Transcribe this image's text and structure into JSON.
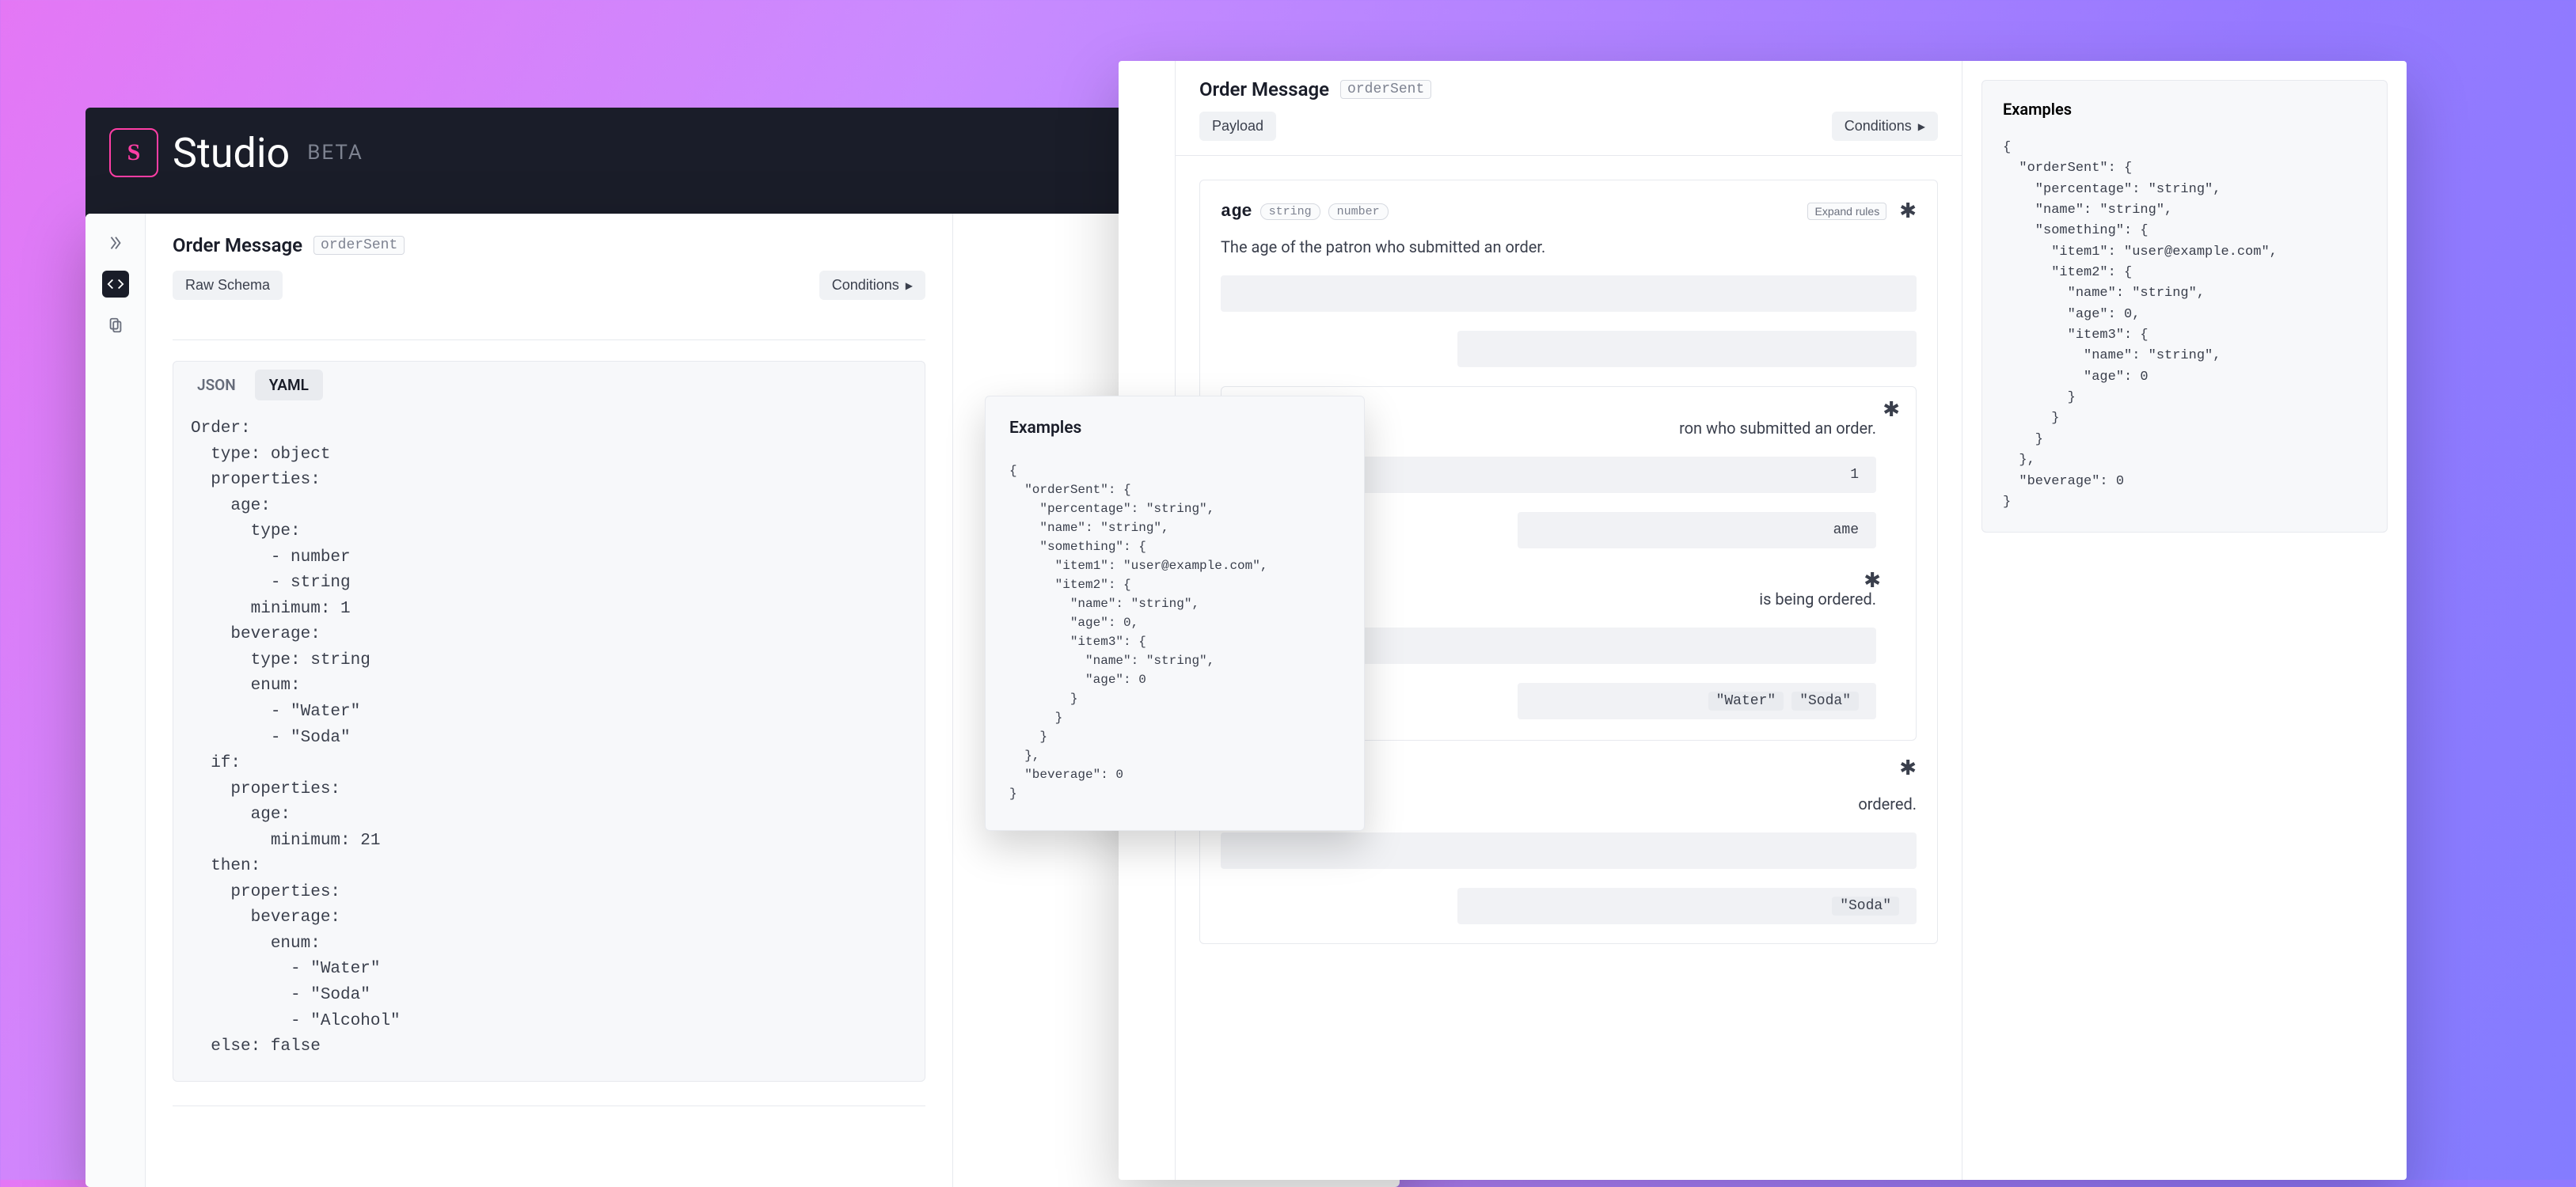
{
  "studio": {
    "name": "Studio",
    "beta": "BETA",
    "logo_letter": "S"
  },
  "left": {
    "title": "Order Message",
    "tag": "orderSent",
    "raw_schema_btn": "Raw Schema",
    "conditions_btn": "Conditions",
    "tabs": {
      "json": "JSON",
      "yaml": "YAML"
    },
    "schema_yaml": "Order:\n  type: object\n  properties:\n    age:\n      type:\n        - number\n        - string\n      minimum: 1\n    beverage:\n      type: string\n      enum:\n        - \"Water\"\n        - \"Soda\"\n  if:\n    properties:\n      age:\n        minimum: 21\n  then:\n    properties:\n      beverage:\n        enum:\n          - \"Water\"\n          - \"Soda\"\n          - \"Alcohol\"\n  else: false"
  },
  "mid_examples": {
    "title": "Examples",
    "code": "{\n  \"orderSent\": {\n    \"percentage\": \"string\",\n    \"name\": \"string\",\n    \"something\": {\n      \"item1\": \"user@example.com\",\n      \"item2\": {\n        \"name\": \"string\",\n        \"age\": 0,\n        \"item3\": {\n          \"name\": \"string\",\n          \"age\": 0\n        }\n      }\n    }\n  },\n  \"beverage\": 0\n}"
  },
  "right": {
    "title": "Order Message",
    "tag": "orderSent",
    "payload_btn": "Payload",
    "conditions_btn": "Conditions",
    "expand_btn": "Expand rules",
    "age_field": {
      "name": "age",
      "types": [
        "string",
        "number"
      ],
      "desc": "The age of the patron who submitted an order."
    },
    "nested": {
      "desc_tail": "ron who submitted an order.",
      "min_value": "1",
      "schema_tail": "ame",
      "bev_desc_tail": "is being ordered.",
      "enum1": "\"Water\"",
      "enum2": "\"Soda\""
    },
    "lower": {
      "ordered_tail": "ordered.",
      "soda": "\"Soda\""
    },
    "examples": {
      "title": "Examples",
      "code": "{\n  \"orderSent\": {\n    \"percentage\": \"string\",\n    \"name\": \"string\",\n    \"something\": {\n      \"item1\": \"user@example.com\",\n      \"item2\": {\n        \"name\": \"string\",\n        \"age\": 0,\n        \"item3\": {\n          \"name\": \"string\",\n          \"age\": 0\n        }\n      }\n    }\n  },\n  \"beverage\": 0\n}"
    }
  }
}
